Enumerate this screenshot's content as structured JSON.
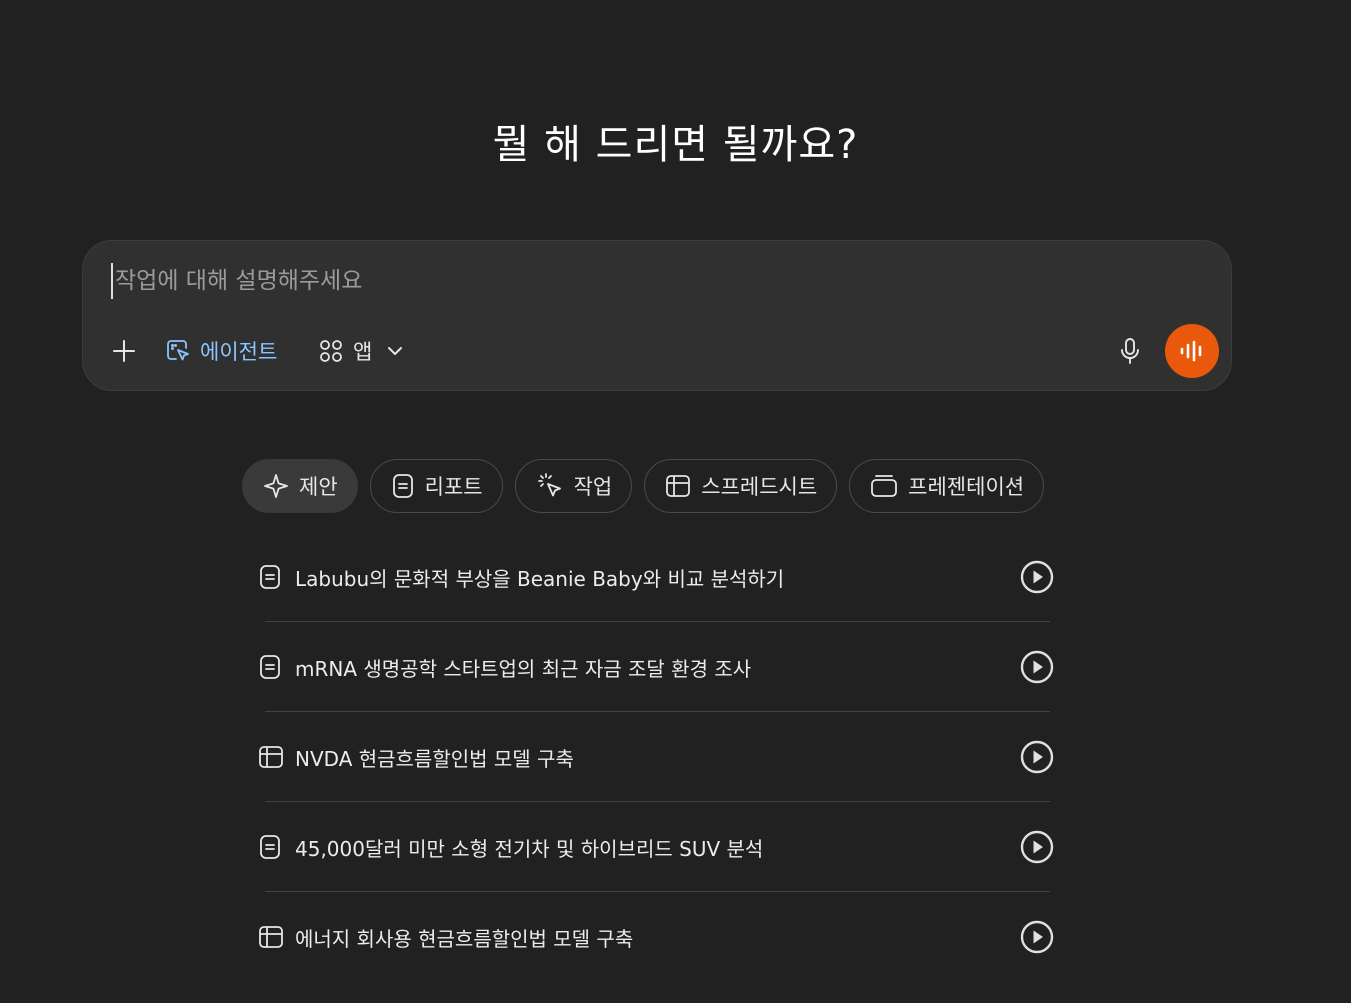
{
  "headline": "뭘 해 드리면 될까요?",
  "composer": {
    "placeholder": "작업에 대해 설명해주세요",
    "agent_label": "에이전트",
    "apps_label": "앱",
    "icons": [
      "plus-icon",
      "agent-cursor-icon",
      "apps-grid-icon",
      "chevron-down-icon",
      "microphone-icon",
      "voice-wave-icon"
    ],
    "voice_button_color": "#e8590c",
    "agent_color": "#8cc4ff"
  },
  "tabs": [
    {
      "label": "제안",
      "icon": "sparkle-icon",
      "active": true
    },
    {
      "label": "리포트",
      "icon": "document-icon",
      "active": false
    },
    {
      "label": "작업",
      "icon": "cursor-click-icon",
      "active": false
    },
    {
      "label": "스프레드시트",
      "icon": "table-icon",
      "active": false
    },
    {
      "label": "프레젠테이션",
      "icon": "presentation-icon",
      "active": false
    }
  ],
  "suggestions": [
    {
      "text": "Labubu의 문화적 부상을 Beanie Baby와 비교 분석하기",
      "icon": "document-icon"
    },
    {
      "text": "mRNA 생명공학 스타트업의 최근 자금 조달 환경 조사",
      "icon": "document-icon"
    },
    {
      "text": "NVDA 현금흐름할인법 모델 구축",
      "icon": "table-icon"
    },
    {
      "text": "45,000달러 미만 소형 전기차 및 하이브리드 SUV 분석",
      "icon": "document-icon"
    },
    {
      "text": "에너지 회사용 현금흐름할인법 모델 구축",
      "icon": "table-icon"
    }
  ],
  "colors": {
    "background": "#212121",
    "composer_bg": "#303030",
    "active_tab_bg": "#3a3a3a",
    "divider": "#424242"
  }
}
